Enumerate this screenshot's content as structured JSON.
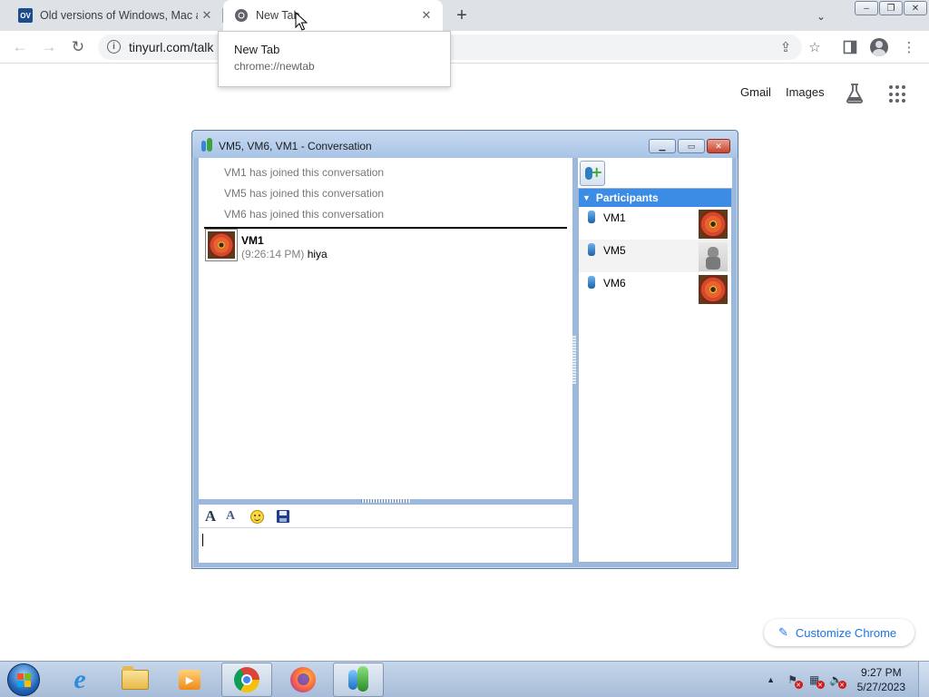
{
  "browser": {
    "tabs": [
      {
        "label": "Old versions of Windows, Mac an",
        "favicon_text": "OV",
        "active": false
      },
      {
        "label": "New Tab",
        "active": true
      }
    ],
    "tooltip": {
      "title": "New Tab",
      "url": "chrome://newtab"
    },
    "omnibox": {
      "url": "tinyurl.com/talk"
    },
    "ntp": {
      "gmail": "Gmail",
      "images": "Images",
      "customize": "Customize Chrome"
    }
  },
  "messenger": {
    "title": "VM5, VM6, VM1 - Conversation",
    "system_messages": [
      "VM1 has joined this conversation",
      "VM5 has joined this conversation",
      "VM6 has joined this conversation"
    ],
    "message": {
      "sender": "VM1",
      "time": "(9:26:14 PM)",
      "text": "hiya"
    },
    "participants_header": "Participants",
    "participants": [
      {
        "name": "VM1",
        "picture": "flower"
      },
      {
        "name": "VM5",
        "picture": "robot"
      },
      {
        "name": "VM6",
        "picture": "flower"
      }
    ],
    "format_toolbar": [
      "font-icon",
      "text-color-icon",
      "emoticon-icon",
      "save-icon"
    ]
  },
  "taskbar": {
    "pinned": [
      "internet-explorer-icon",
      "file-explorer-icon",
      "media-player-icon",
      "chrome-icon",
      "firefox-icon",
      "messenger-icon"
    ],
    "clock_time": "9:27 PM",
    "clock_date": "5/27/2023"
  },
  "colors": {
    "chrome_accent": "#1a73e8",
    "participants_header": "#3c8ce6",
    "taskbar": "#b7c9e2"
  }
}
